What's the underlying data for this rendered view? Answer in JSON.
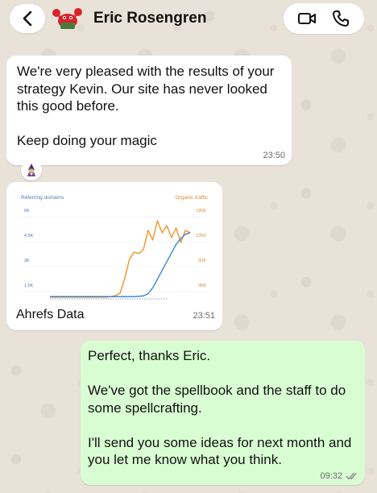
{
  "header": {
    "contact_name": "Eric Rosengren",
    "icons": [
      "chevron-left-icon",
      "crab-avatar",
      "video-call-icon",
      "phone-icon"
    ]
  },
  "messages": [
    {
      "direction": "incoming",
      "text": "We're very pleased with the results of your strategy Kevin. Our site has never looked this good before.\n\nKeep doing your magic",
      "time": "23:50",
      "reaction": "wizard-emoji"
    },
    {
      "direction": "incoming",
      "caption": "Ahrefs Data",
      "time": "23:51"
    },
    {
      "direction": "outgoing",
      "text": "Perfect, thanks Eric.\n\nWe've got the spellbook and the staff to do some spellcrafting.\n\nI'll send you some ideas for next month and you let me know what you think.",
      "time": "09:32",
      "status": "read-double-check-icon"
    }
  ],
  "chart_data": {
    "type": "line",
    "left_axis_label": "Referring domains",
    "right_axis_label": "Organic traffic",
    "left_ticks": [
      "6K",
      "4.5K",
      "3K",
      "1.5K"
    ],
    "right_ticks": [
      "180K",
      "135K",
      "90K",
      "45K"
    ],
    "series": [
      {
        "name": "Organic traffic",
        "color": "#f28c1b",
        "axis": "right",
        "x": [
          0,
          1,
          2,
          3,
          4,
          5,
          6,
          7,
          8,
          9,
          10,
          11,
          12,
          13,
          14,
          15,
          16,
          17,
          18,
          19,
          20,
          21,
          22,
          23,
          24,
          25,
          26,
          27,
          28,
          29,
          30
        ],
        "values": [
          2000,
          2000,
          2000,
          2000,
          2000,
          2000,
          2000,
          2000,
          2000,
          2000,
          2000,
          2000,
          2000,
          3000,
          5000,
          10000,
          40000,
          80000,
          95000,
          92000,
          100000,
          140000,
          120000,
          160000,
          135000,
          150000,
          125000,
          145000,
          115000,
          140000,
          135000
        ]
      },
      {
        "name": "Referring domains",
        "color": "#2d7cd6",
        "axis": "left",
        "x": [
          0,
          1,
          2,
          3,
          4,
          5,
          6,
          7,
          8,
          9,
          10,
          11,
          12,
          13,
          14,
          15,
          16,
          17,
          18,
          19,
          20,
          21,
          22,
          23,
          24,
          25,
          26,
          27,
          28,
          29,
          30
        ],
        "values": [
          100,
          100,
          100,
          100,
          100,
          100,
          100,
          100,
          100,
          100,
          100,
          100,
          100,
          100,
          100,
          100,
          100,
          100,
          100,
          120,
          150,
          300,
          700,
          1300,
          1900,
          2500,
          3100,
          3700,
          4100,
          4400,
          4500
        ]
      }
    ],
    "left_ylim": [
      0,
      6000
    ],
    "right_ylim": [
      0,
      180000
    ],
    "grid": true
  }
}
